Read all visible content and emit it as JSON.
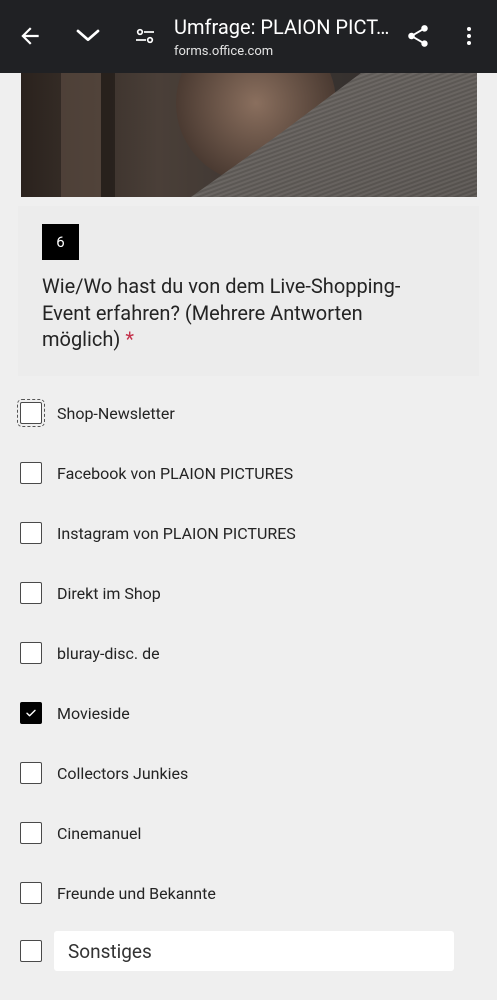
{
  "browser": {
    "title": "Umfrage: PLAION PICT…",
    "url": "forms.office.com"
  },
  "question": {
    "number": "6",
    "text": "Wie/Wo hast du von dem Live-Shopping-Event erfahren? (Mehrere Antworten möglich)",
    "required_marker": "*"
  },
  "options": [
    {
      "label": "Shop-Newsletter",
      "checked": false
    },
    {
      "label": "Facebook von PLAION PICTURES",
      "checked": false
    },
    {
      "label": "Instagram von PLAION PICTURES",
      "checked": false
    },
    {
      "label": "Direkt im Shop",
      "checked": false
    },
    {
      "label": "bluray-disc. de",
      "checked": false
    },
    {
      "label": "Movieside",
      "checked": true
    },
    {
      "label": "Collectors Junkies",
      "checked": false
    },
    {
      "label": "Cinemanuel",
      "checked": false
    },
    {
      "label": "Freunde und Bekannte",
      "checked": false
    }
  ],
  "other_option": {
    "placeholder": "Sonstiges",
    "checked": false
  },
  "icons": {
    "back": "arrow-left-icon",
    "minimize": "chevron-down-icon",
    "tune": "tune-icon",
    "share": "share-icon",
    "menu": "more-vert-icon"
  },
  "colors": {
    "topbar": "#202124",
    "required": "#c4314b",
    "checked": "#000000"
  }
}
